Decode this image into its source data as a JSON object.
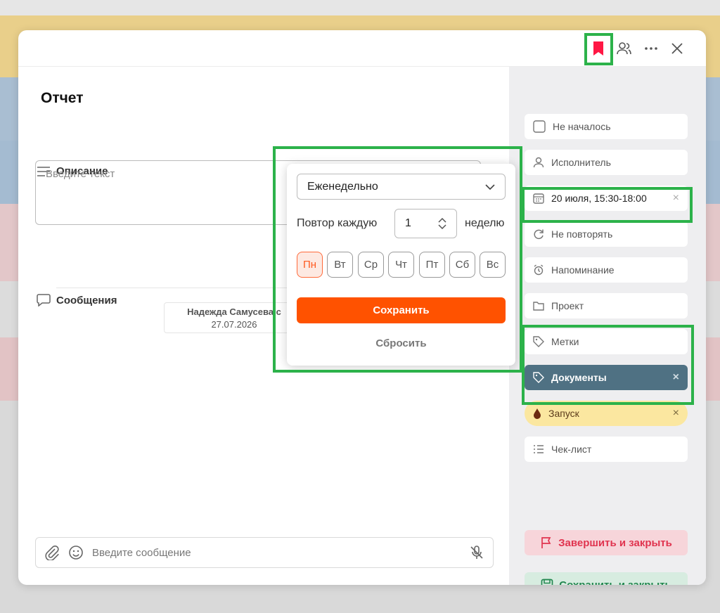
{
  "header": {
    "icons": [
      "bookmark-icon",
      "users-icon",
      "more-icon",
      "close-icon"
    ],
    "bookmark_color": "#ff1744"
  },
  "task": {
    "title": "Отчет",
    "description_label": "Описание",
    "description_placeholder": "Введите текст",
    "messages_label": "Сообщения",
    "message": {
      "author": "Надежда Самусева с",
      "date": "27.07.2026"
    },
    "composer_placeholder": "Введите сообщение"
  },
  "sidebar": {
    "items": [
      {
        "label": "Не началось",
        "icon": "checkbox-icon"
      },
      {
        "label": "Исполнитель",
        "icon": "user-icon"
      },
      {
        "label": "20 июля, 15:30-18:00",
        "icon": "calendar-icon"
      },
      {
        "label": "Не повторять",
        "icon": "repeat-icon"
      },
      {
        "label": "Напоминание",
        "icon": "alarm-icon"
      },
      {
        "label": "Проект",
        "icon": "folder-icon"
      },
      {
        "label": "Метки",
        "icon": "tag-icon"
      },
      {
        "label": "Документы",
        "icon": "tag-icon",
        "color": "#4f7183"
      },
      {
        "label": "Запуск",
        "icon": "drop-icon",
        "color": "#fbe7a0"
      },
      {
        "label": "Чек-лист",
        "icon": "checklist-icon"
      }
    ],
    "finish_label": "Завершить и закрыть",
    "save_close_label": "Сохранить и закрыть"
  },
  "repeat_popup": {
    "frequency": "Еженедельно",
    "repeat_label": "Повтор каждую",
    "interval": "1",
    "unit": "неделю",
    "days": [
      "Пн",
      "Вт",
      "Ср",
      "Чт",
      "Пт",
      "Сб",
      "Вс"
    ],
    "active_day": "Пн",
    "save_label": "Сохранить",
    "reset_label": "Сбросить",
    "accent": "#ff5200"
  }
}
